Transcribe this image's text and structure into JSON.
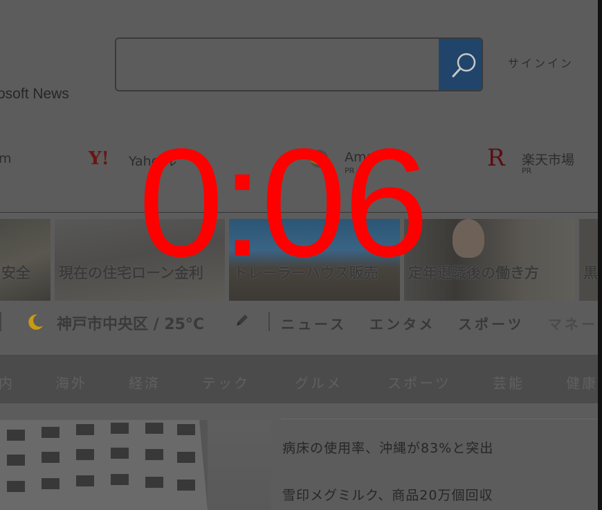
{
  "header": {
    "brand": "osoft News",
    "search": {
      "value": "",
      "placeholder": ""
    },
    "signin": "サインイン"
  },
  "quick_links": [
    {
      "id": "m",
      "label": "m"
    },
    {
      "id": "yahoo",
      "logo": "Y!",
      "label": "Yaho    ル"
    },
    {
      "id": "amazon",
      "label": "Amaz",
      "sub": "PR"
    },
    {
      "id": "rakuten",
      "logo": "R",
      "label": "楽天市場",
      "sub": "PR"
    }
  ],
  "tiles": [
    {
      "caption": "安全"
    },
    {
      "caption": "現在の住宅ローン金利"
    },
    {
      "caption": "トレーラーハウス販売"
    },
    {
      "caption": "定年退職後の働き方"
    },
    {
      "caption": "黒"
    }
  ],
  "weather": {
    "location_temp": "神戸市中央区 / 25°C"
  },
  "top_nav": [
    "ニュース",
    "エンタメ",
    "スポーツ",
    "マネー"
  ],
  "categories": [
    "内",
    "海外",
    "経済",
    "テック",
    "グルメ",
    "スポーツ",
    "芸能",
    "健康"
  ],
  "headlines": [
    "病床の使用率、沖縄が83%と突出",
    "雪印メグミルク、商品20万個回収"
  ],
  "overlay": {
    "timer": "0:06"
  },
  "colors": {
    "search_button": "#21456a",
    "timer": "#ff0000",
    "moon": "#c99a12"
  }
}
